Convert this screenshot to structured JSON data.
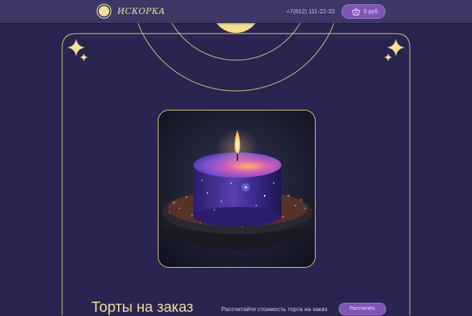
{
  "header": {
    "logo_text": "ИСКОРКА",
    "phone": "+7(812) 111-22-33",
    "cart_label": "0 руб."
  },
  "hero": {
    "title": "Торты на заказ",
    "calc_text": "Рассчитайте стоимость торта на заказ",
    "calc_button": "Рассчитать"
  },
  "colors": {
    "background": "#2a2550",
    "header": "#3d3766",
    "gold": "#f3df9a",
    "accent_button": "#7f55b8"
  },
  "icons": [
    "moon-logo-icon",
    "basket-icon",
    "sparkle-icon"
  ]
}
